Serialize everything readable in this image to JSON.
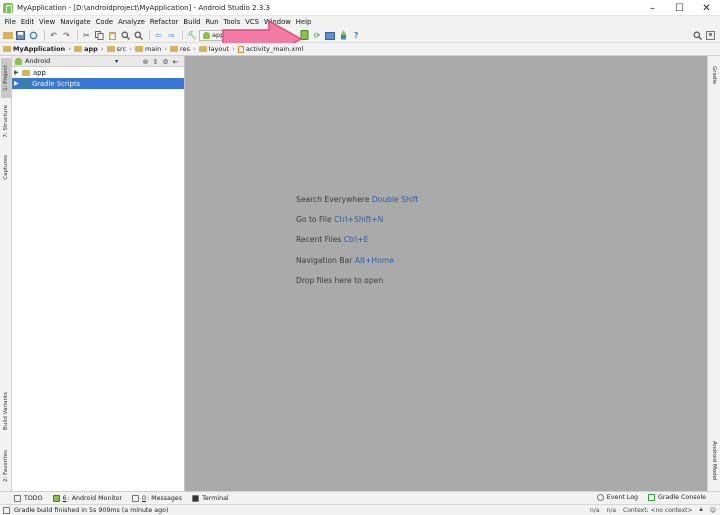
{
  "window": {
    "title": "MyApplication - [D:\\androidproject\\MyApplication] - Android Studio 2.3.3",
    "minimize": "–",
    "maximize": "☐",
    "close": "✕"
  },
  "menu": [
    "File",
    "Edit",
    "View",
    "Navigate",
    "Code",
    "Analyze",
    "Refactor",
    "Build",
    "Run",
    "Tools",
    "VCS",
    "Window",
    "Help"
  ],
  "toolbar": {
    "run_config": "app",
    "run_config_arrow": "▾"
  },
  "breadcrumb": [
    "MyApplication",
    "app",
    "src",
    "main",
    "res",
    "layout",
    "activity_main.xml"
  ],
  "left_tabs": {
    "project": "1: Project",
    "structure": "7: Structure",
    "captures": "Captures",
    "build_variants": "Build Variants",
    "favorites": "2: Favorites"
  },
  "right_tabs": {
    "gradle": "Gradle",
    "android_model": "Android Model"
  },
  "project_panel": {
    "view_mode": "Android",
    "dropdown": "▾",
    "tree": [
      {
        "label": "app",
        "type": "folder",
        "selected": false
      },
      {
        "label": "Gradle Scripts",
        "type": "gradle",
        "selected": true
      }
    ]
  },
  "editor_hints": [
    {
      "text": "Search Everywhere",
      "shortcut": "Double Shift"
    },
    {
      "text": "Go to File",
      "shortcut": "Ctrl+Shift+N"
    },
    {
      "text": "Recent Files",
      "shortcut": "Ctrl+E"
    },
    {
      "text": "Navigation Bar",
      "shortcut": "Alt+Home"
    },
    {
      "text": "Drop files here to open",
      "shortcut": ""
    }
  ],
  "bottom_tabs": {
    "todo": "TODO",
    "android_monitor_num": "6",
    "android_monitor": ": Android Monitor",
    "messages_num": "0",
    "messages": ": Messages",
    "terminal": "Terminal",
    "event_log": "Event Log",
    "gradle_console": "Gradle Console"
  },
  "status": {
    "message": "Gradle build finished in 5s 909ms (a minute ago)",
    "na": "n/a",
    "na2": "n/a",
    "context": "Context: <no context>"
  },
  "colors": {
    "editor_bg": "#aaaaaa",
    "selection": "#3875d7",
    "shortcut": "#2e5ca8",
    "annotation_arrow": "#f27ba4"
  }
}
